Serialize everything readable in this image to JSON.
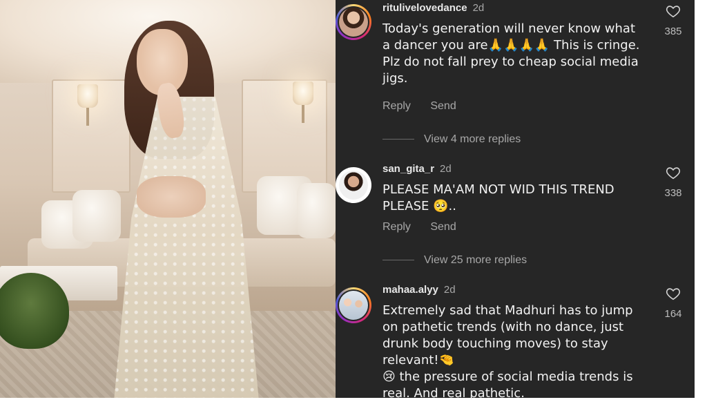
{
  "photo": {
    "alt_name": "woman-in-saree-photo"
  },
  "comments": [
    {
      "username": "ritulivelovedance",
      "time": "2d",
      "text": "Today's generation will never know what a dancer you are🙏🙏🙏🙏 This is cringe. Plz do not fall prey to cheap social media jigs.",
      "likes": "385",
      "reply_label": "Reply",
      "send_label": "Send",
      "view_replies": "View 4 more replies"
    },
    {
      "username": "san_gita_r",
      "time": "2d",
      "text": "PLEASE MA'AM NOT WID THIS TREND PLEASE 🥺..",
      "likes": "338",
      "reply_label": "Reply",
      "send_label": "Send",
      "view_replies": "View 25 more replies"
    },
    {
      "username": "mahaa.alyy",
      "time": "2d",
      "text": "Extremely sad that Madhuri has to jump on pathetic trends (with no dance, just drunk body touching moves) to stay relevant!🤏\n😢 the pressure of social media trends is real. And real pathetic.",
      "likes": "164"
    }
  ],
  "colors": {
    "panel_bg": "#262626",
    "text": "#f2f2f2",
    "muted": "#a8a8a8"
  },
  "icons": {
    "like": "heart-outline-icon"
  }
}
